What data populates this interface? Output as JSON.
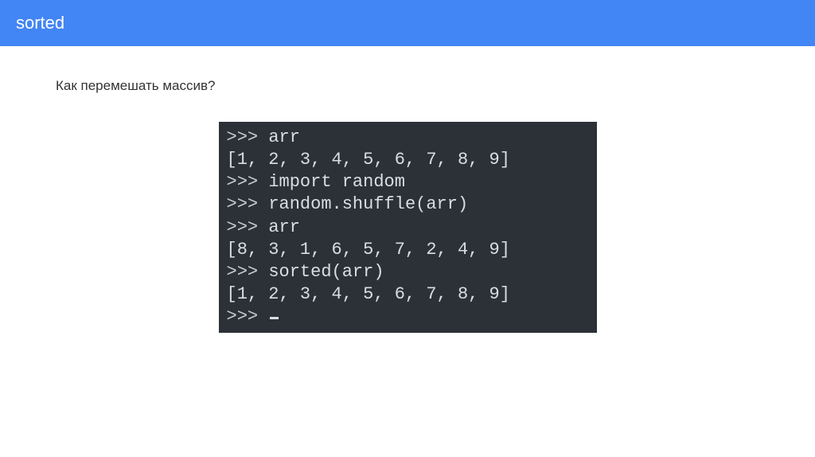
{
  "header": {
    "title": "sorted"
  },
  "content": {
    "question": "Как перемешать массив?"
  },
  "terminal": {
    "lines": [
      {
        "prompt": ">>> ",
        "text": "arr"
      },
      {
        "prompt": "",
        "text": "[1, 2, 3, 4, 5, 6, 7, 8, 9]"
      },
      {
        "prompt": ">>> ",
        "text": "import random"
      },
      {
        "prompt": ">>> ",
        "text": "random.shuffle(arr)"
      },
      {
        "prompt": ">>> ",
        "text": "arr"
      },
      {
        "prompt": "",
        "text": "[8, 3, 1, 6, 5, 7, 2, 4, 9]"
      },
      {
        "prompt": ">>> ",
        "text": "sorted(arr)"
      },
      {
        "prompt": "",
        "text": "[1, 2, 3, 4, 5, 6, 7, 8, 9]"
      },
      {
        "prompt": ">>> ",
        "text": ""
      }
    ]
  }
}
